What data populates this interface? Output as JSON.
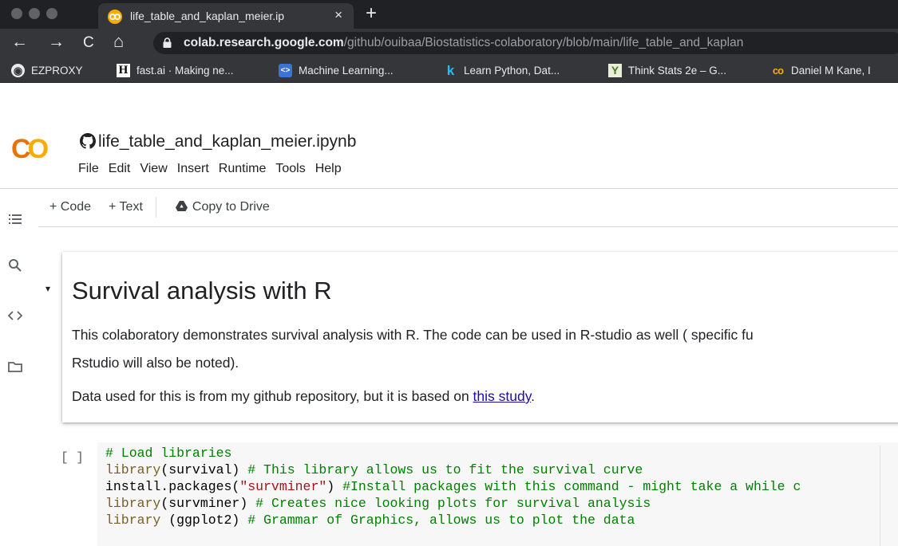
{
  "browser": {
    "tab": {
      "title": "life_table_and_kaplan_meier.ip",
      "close": "×",
      "favicon": "colab-icon"
    },
    "new_tab": "+",
    "nav": {
      "back": "←",
      "forward": "→",
      "reload": "C",
      "home": "⌂"
    },
    "url": {
      "host": "colab.research.google.com",
      "path": "/github/ouibaa/Biostatistics-colaboratory/blob/main/life_table_and_kaplan"
    }
  },
  "bookmarks": [
    {
      "label": "EZPROXY",
      "icon": "globe-icon",
      "glyph": "◉"
    },
    {
      "label": "fast.ai · Making ne...",
      "icon": "hn-icon",
      "glyph": "H"
    },
    {
      "label": "Machine Learning...",
      "icon": "code-badge-icon",
      "glyph": "<>"
    },
    {
      "label": "Learn Python, Dat...",
      "icon": "k-icon",
      "glyph": "k"
    },
    {
      "label": "Think Stats 2e – G...",
      "icon": "plant-icon",
      "glyph": "Y"
    },
    {
      "label": "Daniel M Kane, I",
      "icon": "colab-icon",
      "glyph": "co"
    }
  ],
  "colab": {
    "logo": {
      "c": "C",
      "o": "O"
    },
    "notebook_title": "life_table_and_kaplan_meier.ipynb",
    "menu": [
      "File",
      "Edit",
      "View",
      "Insert",
      "Runtime",
      "Tools",
      "Help"
    ],
    "toolbar": {
      "code": "+ Code",
      "text": "+ Text",
      "copy_to_drive": "Copy to Drive"
    },
    "rail": [
      "toc-icon",
      "search-icon",
      "code-snippets-icon",
      "folder-icon"
    ]
  },
  "text_cell": {
    "collapse": "▾",
    "heading": "Survival analysis with R",
    "para1_line1": "This colaboratory demonstrates survival analysis with R. The code can be used in R-studio as well ( specific fu",
    "para1_line2": "Rstudio will also be noted).",
    "para2_before": "Data used for this is from my github repository, but it is based on ",
    "para2_link": "this study",
    "para2_after": "."
  },
  "code_cell": {
    "run_bracket": "[ ]",
    "lines": [
      [
        {
          "t": "# Load libraries",
          "c": "comment"
        }
      ],
      [
        {
          "t": "library",
          "c": "fn"
        },
        {
          "t": "(survival) ",
          "c": "plain"
        },
        {
          "t": "# This library allows us to fit the survival curve",
          "c": "comment"
        }
      ],
      [
        {
          "t": "install.packages(",
          "c": "plain"
        },
        {
          "t": "\"survminer\"",
          "c": "str"
        },
        {
          "t": ") ",
          "c": "plain"
        },
        {
          "t": "#Install packages with this command - might take a while c",
          "c": "comment"
        }
      ],
      [
        {
          "t": "library",
          "c": "fn"
        },
        {
          "t": "(survminer) ",
          "c": "plain"
        },
        {
          "t": "# Creates nice looking plots for survival analysis",
          "c": "comment"
        }
      ],
      [
        {
          "t": "library",
          "c": "fn"
        },
        {
          "t": " (ggplot2) ",
          "c": "plain"
        },
        {
          "t": "# Grammar of Graphics, allows us to plot the data",
          "c": "comment"
        }
      ]
    ]
  },
  "colors": {
    "chrome_dark": "#202124",
    "chrome_toolbar": "#35363a",
    "colab_orange": "#f9ab00",
    "colab_orange_dark": "#e8710a",
    "link": "#1a0dab",
    "code_comment": "#008000",
    "code_string": "#a31515"
  }
}
